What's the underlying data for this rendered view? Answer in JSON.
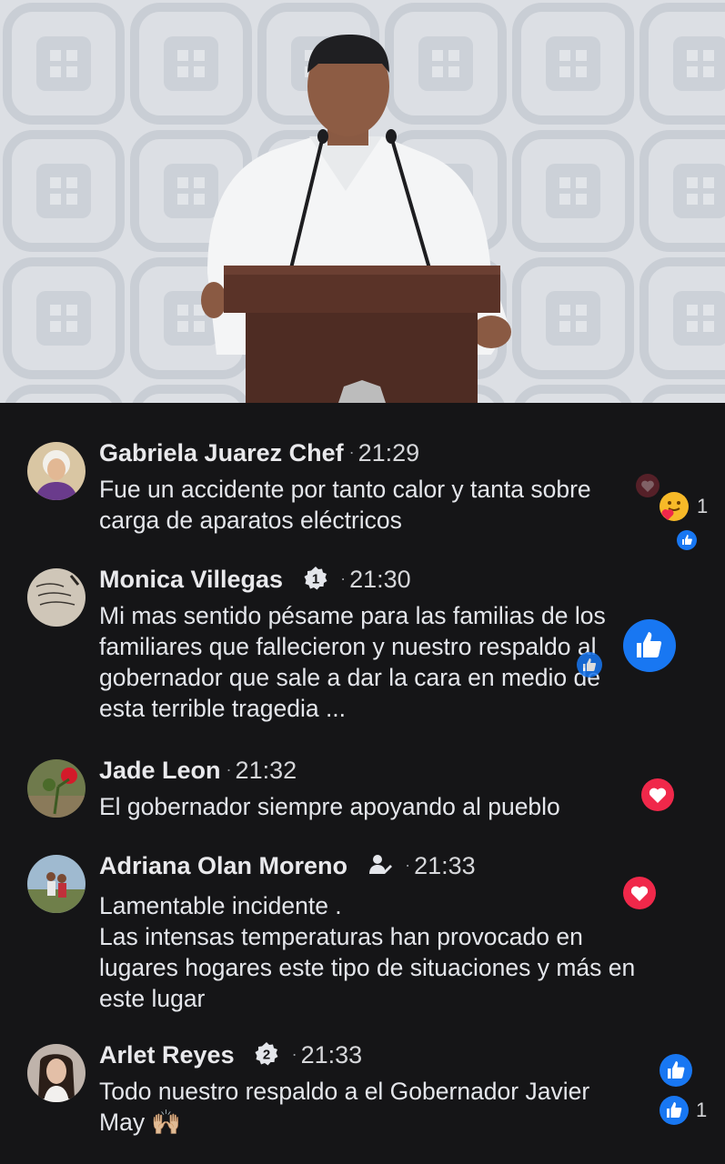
{
  "comments": [
    {
      "name": "Gabriela Juarez Chef",
      "time": "21:29",
      "text": "Fue un accidente por tanto calor y tanta sobre\ncarga de aparatos eléctricos",
      "reaction_count": "1"
    },
    {
      "name": "Monica Villegas",
      "badge": "1",
      "time": "21:30",
      "text": "Mi mas sentido pésame para las familias de los\nfamiliares que fallecieron y nuestro respaldo al\ngobernador que sale a dar la cara en medio de\nesta terrible tragedia ..."
    },
    {
      "name": "Jade Leon",
      "time": "21:32",
      "text": "El gobernador siempre apoyando  al pueblo"
    },
    {
      "name": "Adriana Olan Moreno",
      "time": "21:33",
      "text": "Lamentable incidente .\nLas intensas temperaturas han provocado en\nlugares hogares este tipo de situaciones y más en\neste lugar"
    },
    {
      "name": "Arlet Reyes",
      "badge": "2",
      "time": "21:33",
      "text": "Todo nuestro respaldo a el Gobernador Javier\nMay 🙌🏼",
      "reaction_count": "1"
    }
  ],
  "separator": "·",
  "colors": {
    "like": "#1877f2",
    "love": "#f0284a",
    "background": "#151517",
    "name": "#e9e9ec"
  }
}
